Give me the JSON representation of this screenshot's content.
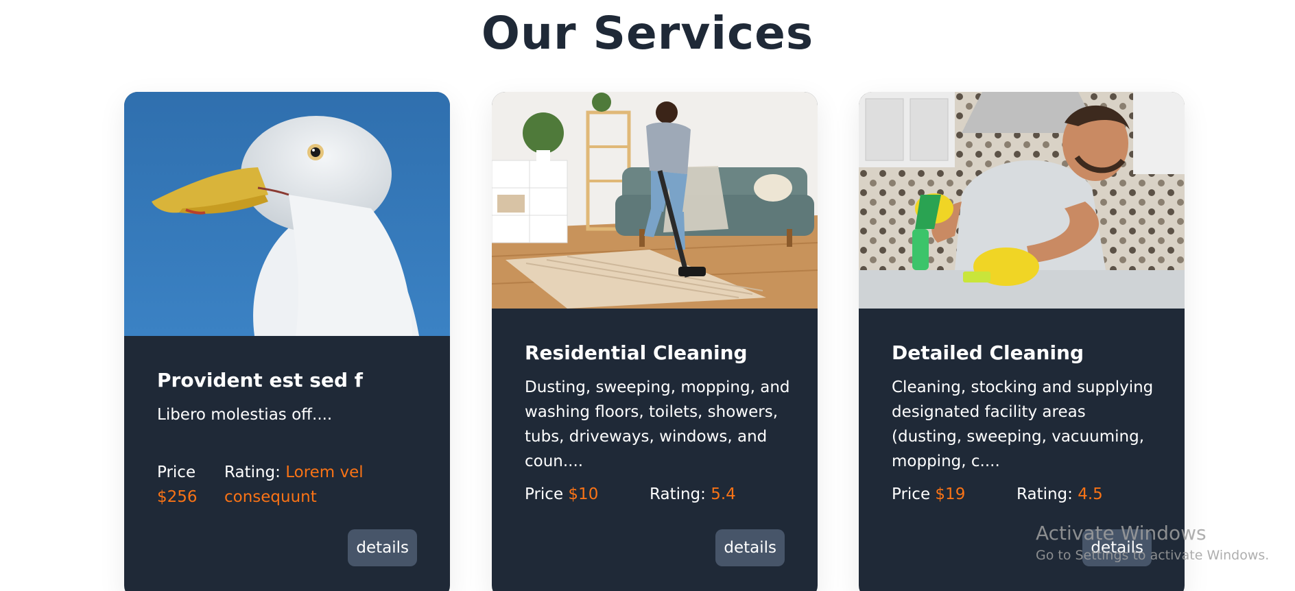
{
  "section": {
    "title": "Our Services"
  },
  "cards": [
    {
      "image_alt": "Seagull head against blue sky",
      "title": "Provident est sed f",
      "description": "Libero molestias off....",
      "price_label": "Price",
      "price_value": "$256",
      "rating_label": "Rating:",
      "rating_value": "Lorem vel consequunt",
      "details_label": "details"
    },
    {
      "image_alt": "Man vacuuming a rug in living room",
      "title": "Residential Cleaning",
      "description": "Dusting, sweeping, mopping, and washing floors, toilets, showers, tubs, driveways, windows, and coun....",
      "price_label": "Price",
      "price_value": "$10",
      "rating_label": "Rating:",
      "rating_value": "5.4",
      "details_label": "details"
    },
    {
      "image_alt": "Man cleaning a kitchen counter with spray bottle",
      "title": "Detailed Cleaning",
      "description": "Cleaning, stocking and supplying designated facility areas (dusting, sweeping, vacuuming, mopping, c....",
      "price_label": "Price",
      "price_value": "$19",
      "rating_label": "Rating:",
      "rating_value": "4.5",
      "details_label": "details"
    }
  ],
  "watermark": {
    "title": "Activate Windows",
    "subtitle": "Go to Settings to activate Windows."
  },
  "colors": {
    "card_bg": "#1f2937",
    "accent": "#f97316",
    "button_bg": "#475569",
    "title": "#1f2937"
  }
}
